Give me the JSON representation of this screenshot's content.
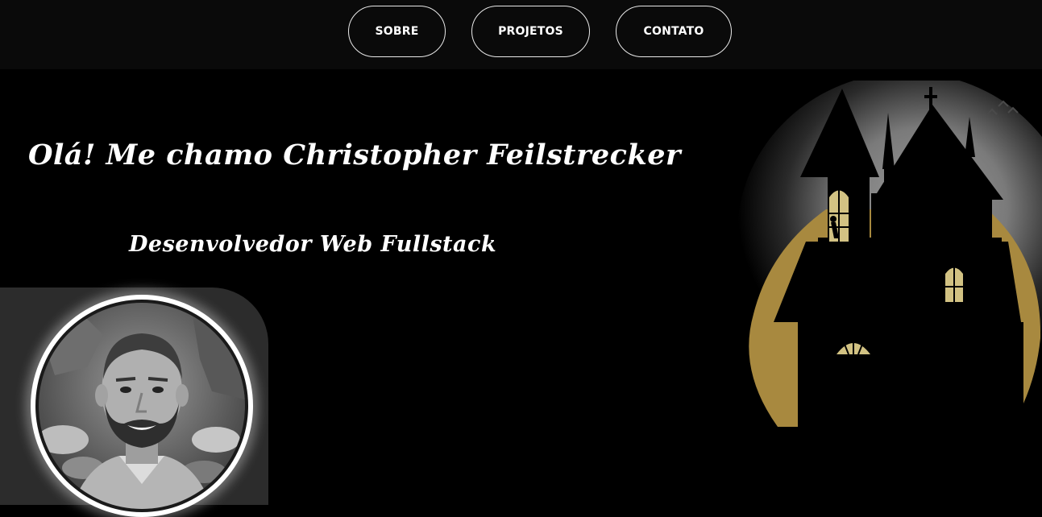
{
  "nav": {
    "items": [
      {
        "label": "SOBRE"
      },
      {
        "label": "PROJETOS"
      },
      {
        "label": "CONTATO"
      }
    ]
  },
  "hero": {
    "title": "Olá! Me chamo Christopher Feilstrecker",
    "subtitle": "Desenvolvedor Web Fullstack"
  },
  "profile": {
    "photo_icon": "person-photo"
  },
  "illustration": {
    "icon": "haunted-house-icon",
    "moon_color": "#a8893f",
    "window_color": "#d2c283"
  },
  "colors": {
    "background": "#000000",
    "topbar": "#0a0a0a",
    "panel": "#2c2c2c",
    "text": "#ffffff"
  }
}
